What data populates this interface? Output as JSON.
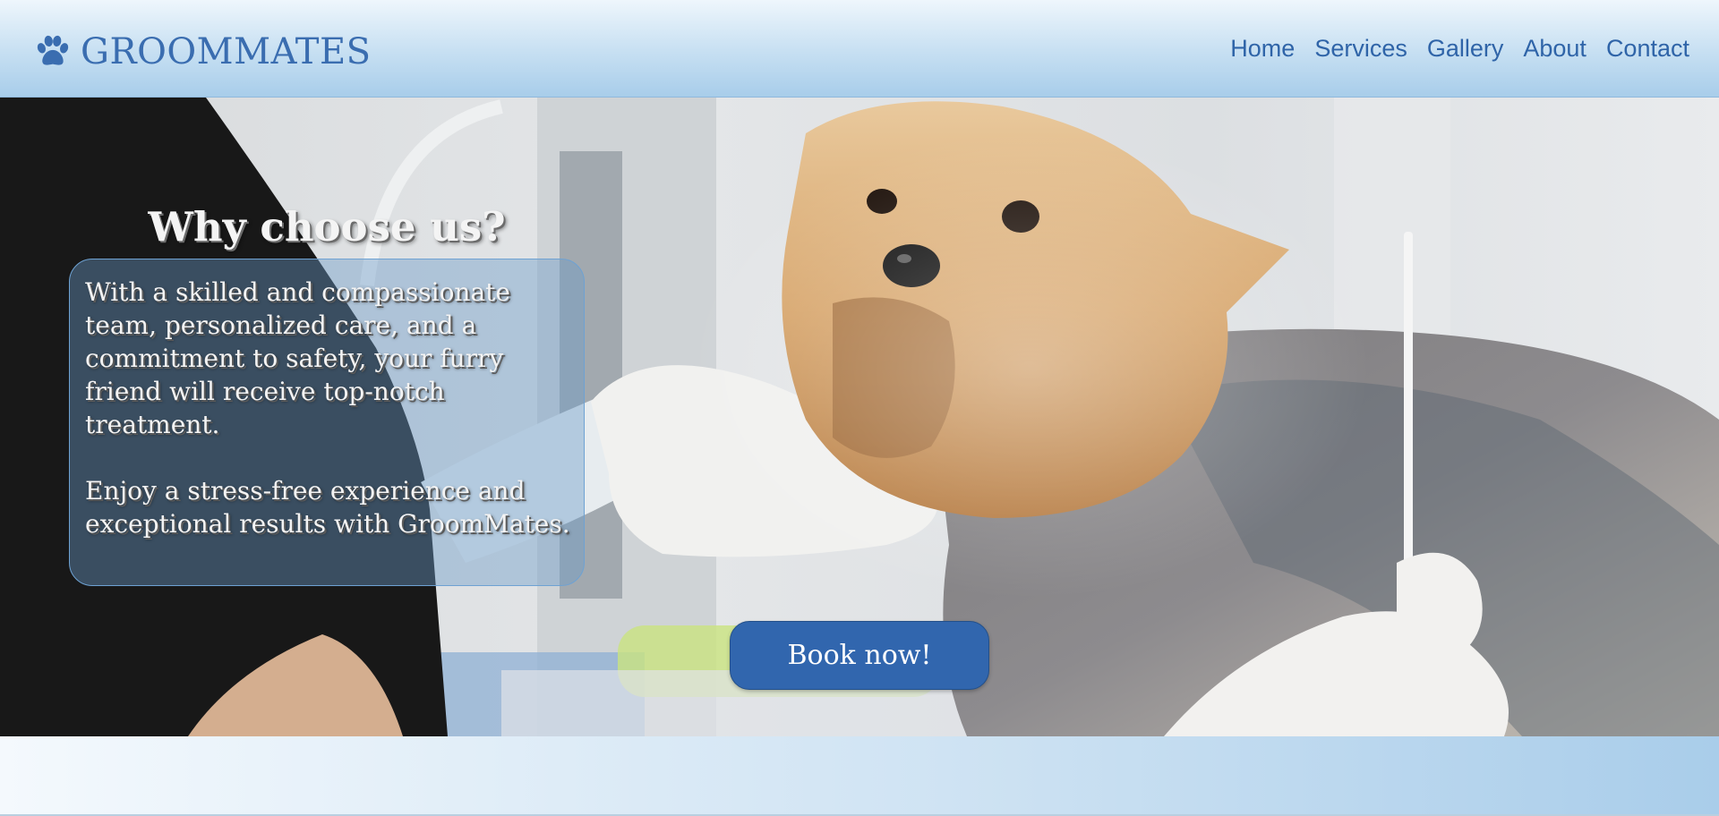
{
  "header": {
    "brand": "GROOMMATES",
    "logo_icon": "paw-icon",
    "nav": [
      "Home",
      "Services",
      "Gallery",
      "About",
      "Contact"
    ]
  },
  "hero": {
    "heading": "Why choose us?",
    "paragraphs": [
      "With a skilled and compassionate team, personalized care, and a commitment to safety, your furry friend will receive top-notch treatment.",
      "Enjoy a stress-free experience and exceptional results with GroomMates."
    ],
    "cta_label": "Book now!"
  },
  "colors": {
    "brand_blue": "#3a6db0",
    "nav_text": "#2f64a8",
    "button_bg": "#3166ae",
    "header_gradient_light": "#eef6fc",
    "header_gradient_dark": "#a8cdea"
  }
}
